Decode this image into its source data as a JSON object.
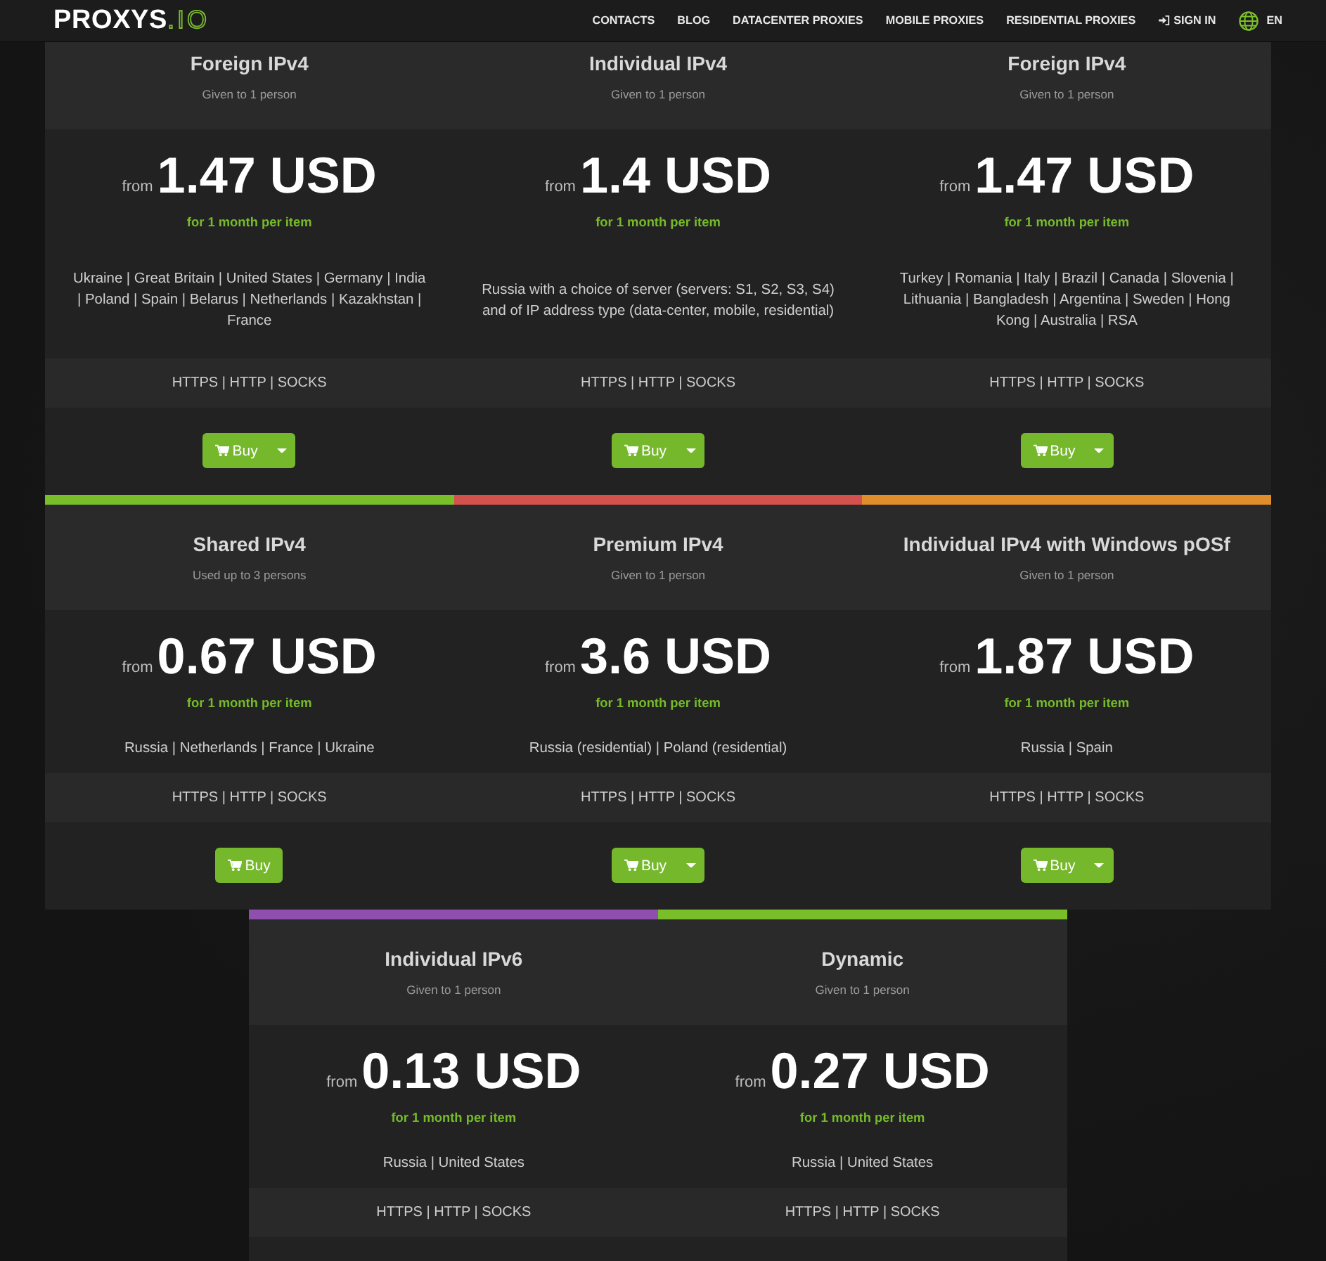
{
  "header": {
    "logo": {
      "main": "PROXYS",
      "suffix": ".IO"
    },
    "nav": [
      {
        "label": "CONTACTS",
        "kind": "link"
      },
      {
        "label": "BLOG",
        "kind": "link"
      },
      {
        "label": "DATACENTER PROXIES",
        "kind": "link"
      },
      {
        "label": "MOBILE PROXIES",
        "kind": "link"
      },
      {
        "label": "RESIDENTIAL PROXIES",
        "kind": "link"
      },
      {
        "label": "SIGN IN",
        "kind": "signin"
      }
    ],
    "language": "EN"
  },
  "rows": [
    [
      {
        "title": "Foreign IPv4",
        "subtitle": "Given to 1 person",
        "from": "from",
        "price": "1.47 USD",
        "period": "for 1 month per item",
        "countries": "Ukraine | Great Britain | United States | Germany | India | Poland | Spain | Belarus | Netherlands | Kazakhstan | France",
        "protocols": "HTTPS | HTTP | SOCKS",
        "buy": {
          "label": "Buy",
          "dropdown": true
        }
      },
      {
        "title": "Individual IPv4",
        "subtitle": "Given to 1 person",
        "from": "from",
        "price": "1.4 USD",
        "period": "for 1 month per item",
        "countries": "Russia with a choice of server (servers: S1, S2, S3, S4) and of IP address type (data-center, mobile, residential)",
        "protocols": "HTTPS | HTTP | SOCKS",
        "buy": {
          "label": "Buy",
          "dropdown": true
        }
      },
      {
        "title": "Foreign IPv4",
        "subtitle": "Given to 1 person",
        "from": "from",
        "price": "1.47 USD",
        "period": "for 1 month per item",
        "countries": "Turkey | Romania | Italy | Brazil | Canada | Slovenia | Lithuania | Bangladesh | Argentina | Sweden | Hong Kong | Australia | RSA",
        "protocols": "HTTPS | HTTP | SOCKS",
        "buy": {
          "label": "Buy",
          "dropdown": true
        }
      }
    ],
    [
      {
        "color": "#79bf2a",
        "title": "Shared IPv4",
        "subtitle": "Used up to 3 persons",
        "from": "from",
        "price": "0.67 USD",
        "period": "for 1 month per item",
        "countries": "Russia | Netherlands | France | Ukraine",
        "protocols": "HTTPS | HTTP | SOCKS",
        "buy": {
          "label": "Buy",
          "dropdown": false
        }
      },
      {
        "color": "#d4524e",
        "title": "Premium IPv4",
        "subtitle": "Given to 1 person",
        "from": "from",
        "price": "3.6 USD",
        "period": "for 1 month per item",
        "countries": "Russia (residential) | Poland (residential)",
        "protocols": "HTTPS | HTTP | SOCKS",
        "buy": {
          "label": "Buy",
          "dropdown": true
        }
      },
      {
        "color": "#e08d2b",
        "title": "Individual IPv4 with Windows pOSf",
        "subtitle": "Given to 1 person",
        "from": "from",
        "price": "1.87 USD",
        "period": "for 1 month per item",
        "countries": "Russia | Spain",
        "protocols": "HTTPS | HTTP | SOCKS",
        "buy": {
          "label": "Buy",
          "dropdown": true
        }
      }
    ],
    [
      {
        "color": "#8e4fae",
        "title": "Individual IPv6",
        "subtitle": "Given to 1 person",
        "from": "from",
        "price": "0.13 USD",
        "period": "for 1 month per item",
        "countries": "Russia | United States",
        "protocols": "HTTPS | HTTP | SOCKS"
      },
      {
        "color": "#79bf2a",
        "title": "Dynamic",
        "subtitle": "Given to 1 person",
        "from": "from",
        "price": "0.27 USD",
        "period": "for 1 month per item",
        "countries": "Russia | United States",
        "protocols": "HTTPS | HTTP | SOCKS"
      }
    ]
  ]
}
